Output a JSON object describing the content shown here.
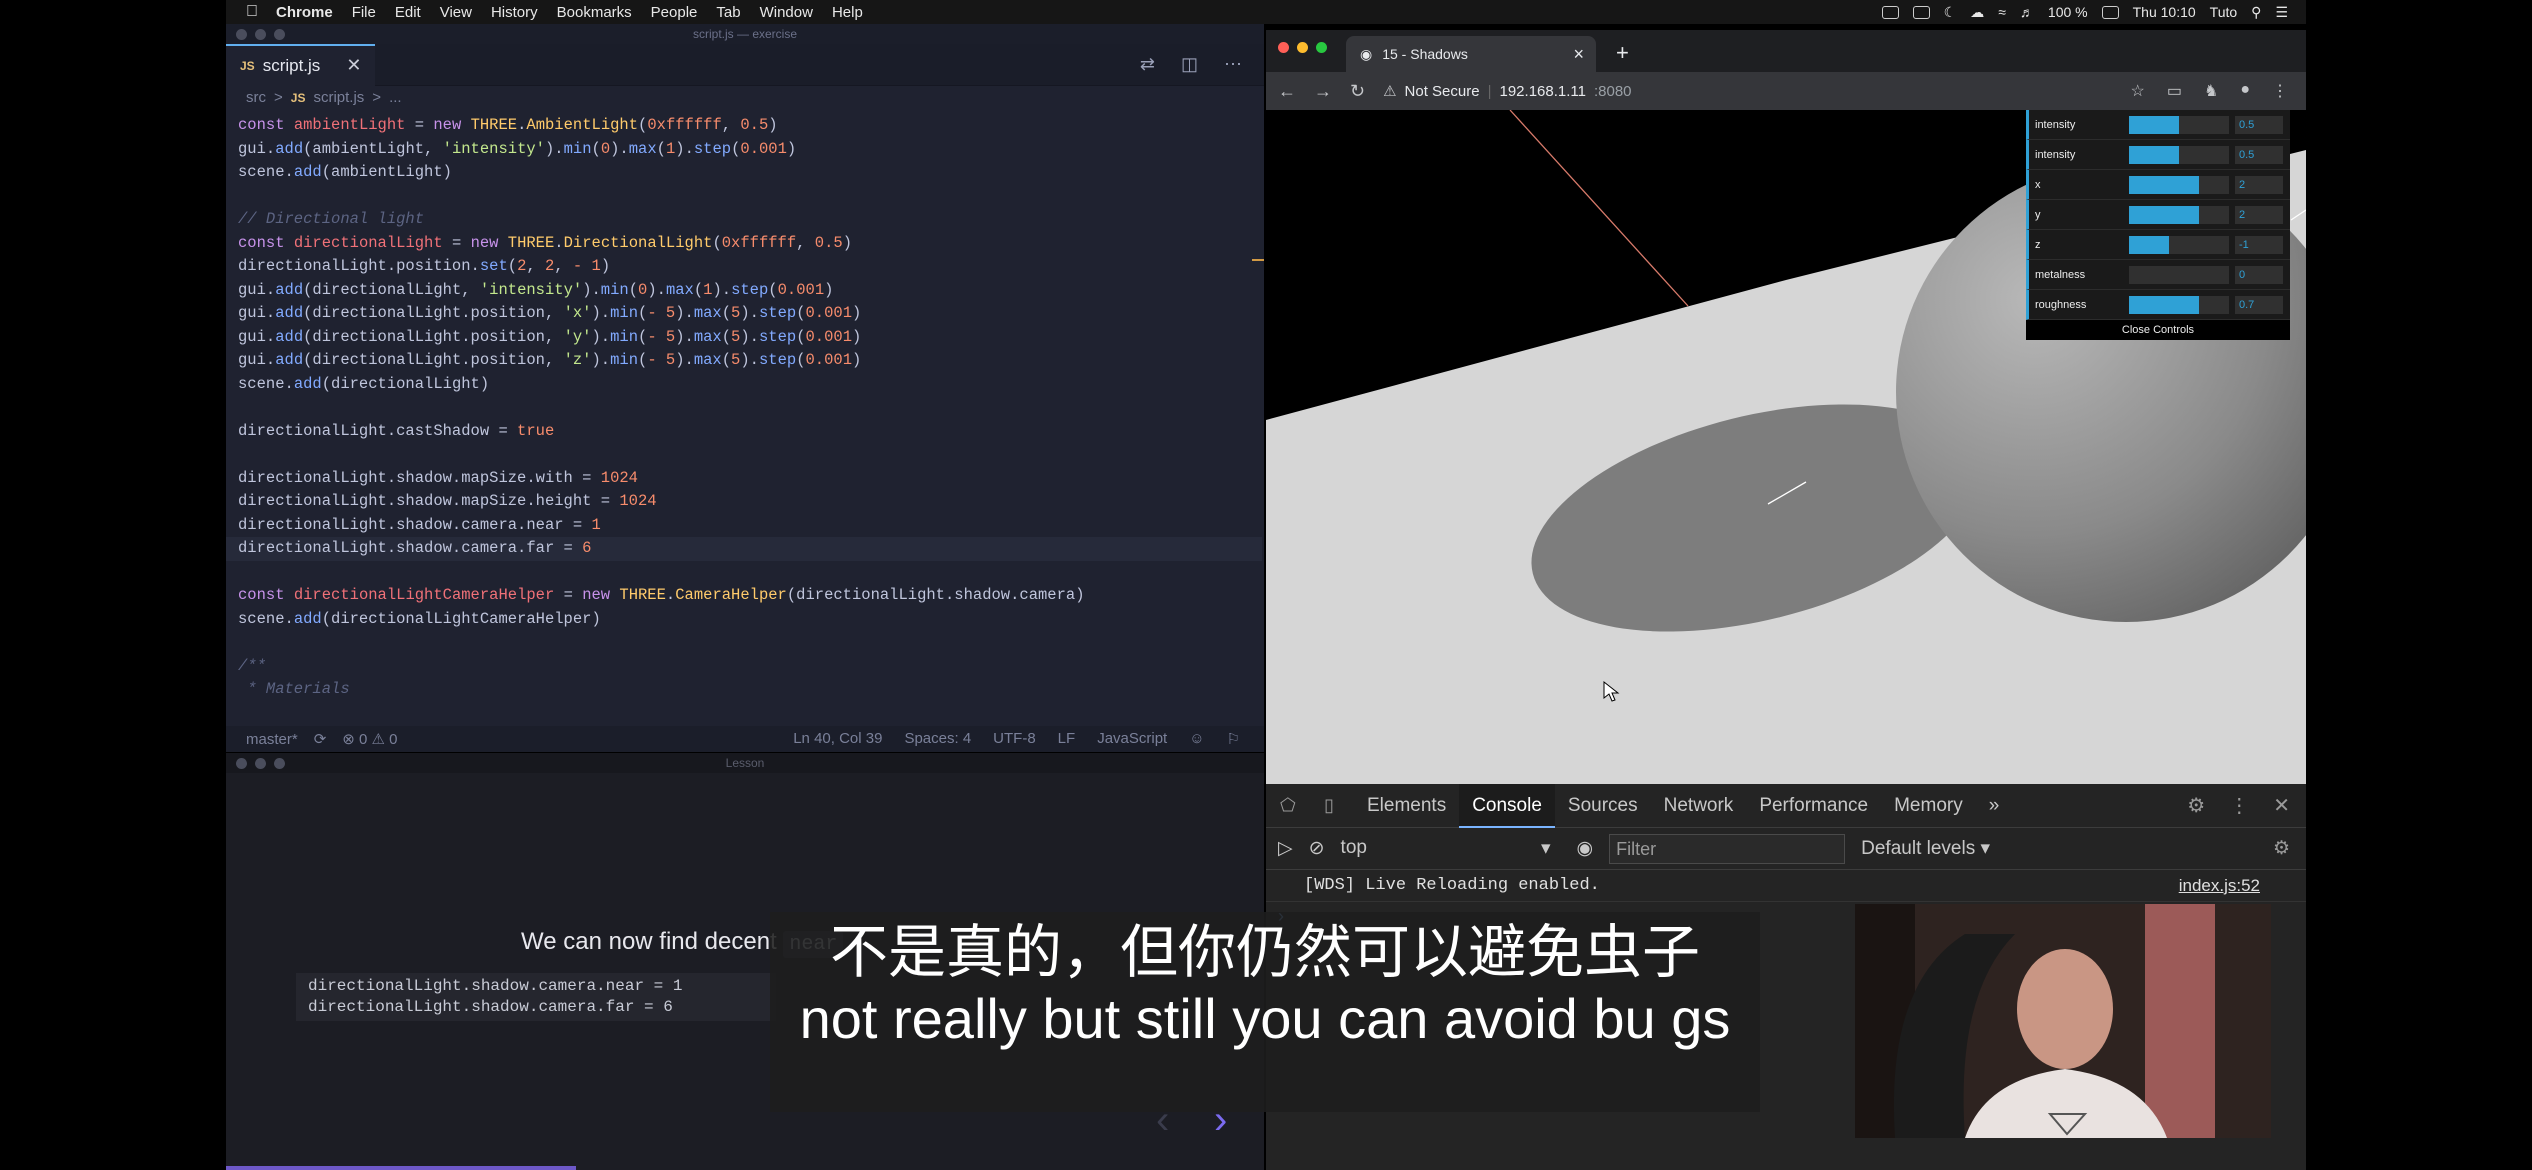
{
  "menubar": {
    "app": "Chrome",
    "items": [
      "File",
      "Edit",
      "View",
      "History",
      "Bookmarks",
      "People",
      "Tab",
      "Window",
      "Help"
    ],
    "battery": "100 %",
    "clock": "Thu 10:10",
    "user": "Tuto"
  },
  "vscode": {
    "title": "script.js — exercise",
    "tab": "script.js",
    "breadcrumb": [
      "src",
      ">",
      "JS",
      "script.js",
      ">",
      "..."
    ],
    "status": {
      "branch": "master*",
      "problems": "⊗ 0 ⚠ 0",
      "position": "Ln 40, Col 39",
      "spaces": "Spaces: 4",
      "encoding": "UTF-8",
      "eol": "LF",
      "language": "JavaScript"
    }
  },
  "lesson": {
    "title": "Lesson",
    "text": "We can now find decent",
    "inline_code": "near",
    "code_line1": "directionalLight.shadow.camera.near = 1",
    "code_line2": "directionalLight.shadow.camera.far = 6",
    "prev": "‹",
    "next": "›"
  },
  "chrome": {
    "tab_title": "15 - Shadows",
    "not_secure": "Not Secure",
    "host": "192.168.1.11",
    "port": ":8080"
  },
  "gui": {
    "rows": [
      {
        "label": "intensity",
        "value": "0.5",
        "fill": 0.5
      },
      {
        "label": "intensity",
        "value": "0.5",
        "fill": 0.5
      },
      {
        "label": "x",
        "value": "2",
        "fill": 0.7
      },
      {
        "label": "y",
        "value": "2",
        "fill": 0.7
      },
      {
        "label": "z",
        "value": "-1",
        "fill": 0.4
      },
      {
        "label": "metalness",
        "value": "0",
        "fill": 0
      },
      {
        "label": "roughness",
        "value": "0.7",
        "fill": 0.7
      }
    ],
    "close": "Close Controls"
  },
  "devtools": {
    "tabs": [
      "Elements",
      "Console",
      "Sources",
      "Network",
      "Performance",
      "Memory",
      "»"
    ],
    "context": "top",
    "filter_placeholder": "Filter",
    "levels": "Default levels ▾",
    "log": "[WDS] Live Reloading enabled.",
    "log_source": "index.js:52",
    "prompt": "›"
  },
  "subtitles": {
    "cn": "不是真的，但你仍然可以避免虫子",
    "en": "not really but still you can avoid bu gs"
  },
  "colors": {
    "gui_accent": "#2fa1d6",
    "vscode_bg": "#1f2230",
    "lesson_accent": "#6d58c8"
  }
}
